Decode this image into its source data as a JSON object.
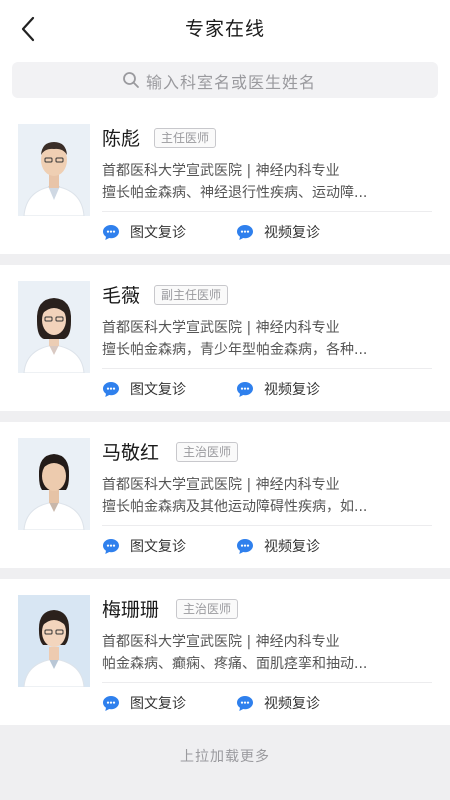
{
  "header": {
    "title": "专家在线"
  },
  "search": {
    "placeholder": "输入科室名或医生姓名"
  },
  "doctors": [
    {
      "name": "陈彪",
      "title": "主任医师",
      "hospital": "首都医科大学宣武医院 | 神经内科专业",
      "expertise": "擅长帕金森病、神经退行性疾病、运动障...",
      "services": [
        "图文复诊",
        "视频复诊"
      ]
    },
    {
      "name": "毛薇",
      "title": "副主任医师",
      "hospital": "首都医科大学宣武医院 | 神经内科专业",
      "expertise": "擅长帕金森病，青少年型帕金森病，各种...",
      "services": [
        "图文复诊",
        "视频复诊"
      ]
    },
    {
      "name": "马敬红",
      "title": "主治医师",
      "hospital": "首都医科大学宣武医院 | 神经内科专业",
      "expertise": "擅长帕金森病及其他运动障碍性疾病，如...",
      "services": [
        "图文复诊",
        "视频复诊"
      ]
    },
    {
      "name": "梅珊珊",
      "title": "主治医师",
      "hospital": "首都医科大学宣武医院 | 神经内科专业",
      "expertise": "帕金森病、癫痫、疼痛、面肌痉挛和抽动...",
      "services": [
        "图文复诊",
        "视频复诊"
      ]
    }
  ],
  "footer": {
    "load_more": "上拉加载更多"
  },
  "colors": {
    "accent_blue": "#2f80ed",
    "badge_border": "#c8c8cc",
    "background": "#efeff1"
  }
}
